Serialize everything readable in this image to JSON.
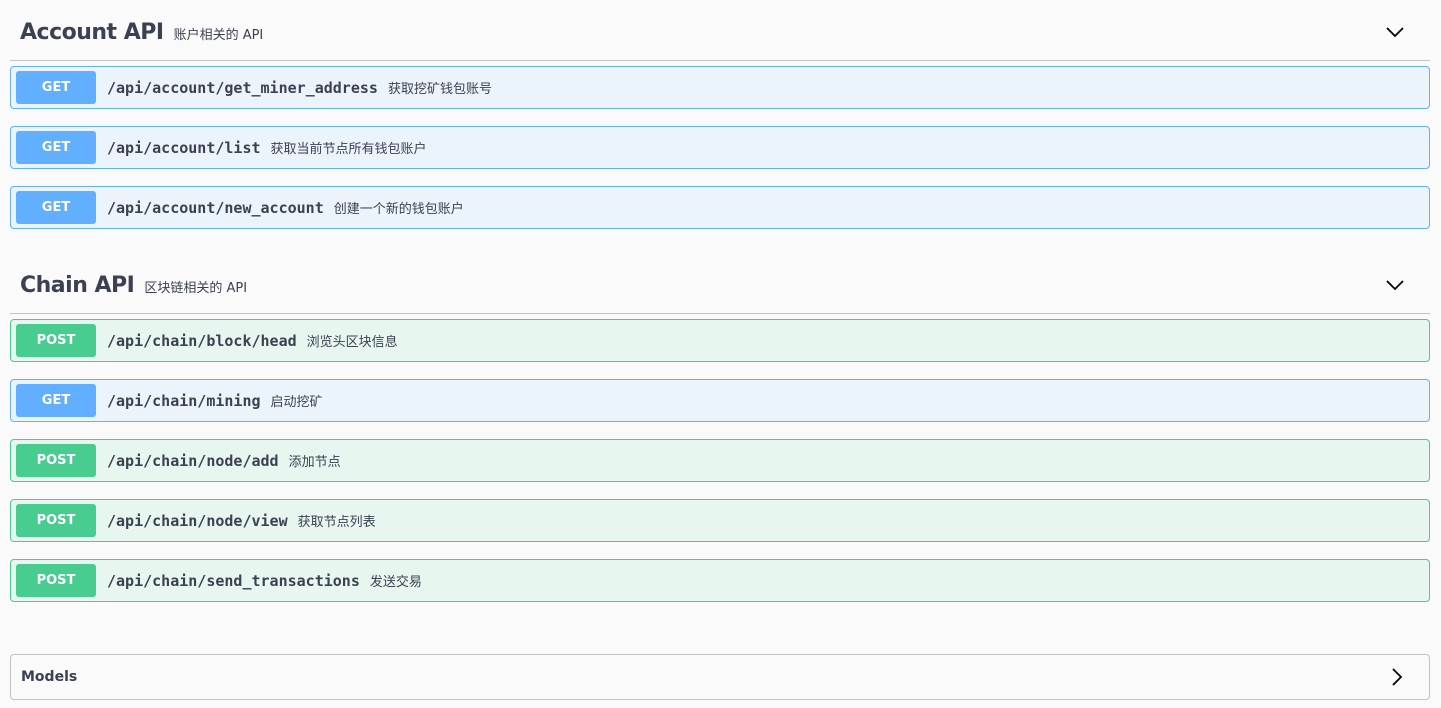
{
  "sections": [
    {
      "title": "Account API",
      "description": "账户相关的 API",
      "operations": [
        {
          "method": "GET",
          "path": "/api/account/get_miner_address",
          "summary": "获取挖矿钱包账号"
        },
        {
          "method": "GET",
          "path": "/api/account/list",
          "summary": "获取当前节点所有钱包账户"
        },
        {
          "method": "GET",
          "path": "/api/account/new_account",
          "summary": "创建一个新的钱包账户"
        }
      ]
    },
    {
      "title": "Chain API",
      "description": "区块链相关的 API",
      "operations": [
        {
          "method": "POST",
          "path": "/api/chain/block/head",
          "summary": "浏览头区块信息"
        },
        {
          "method": "GET",
          "path": "/api/chain/mining",
          "summary": "启动挖矿"
        },
        {
          "method": "POST",
          "path": "/api/chain/node/add",
          "summary": "添加节点"
        },
        {
          "method": "POST",
          "path": "/api/chain/node/view",
          "summary": "获取节点列表"
        },
        {
          "method": "POST",
          "path": "/api/chain/send_transactions",
          "summary": "发送交易"
        }
      ]
    }
  ],
  "models": {
    "title": "Models"
  },
  "icons": {
    "section_toggle": "chevron-down-icon",
    "models_toggle": "chevron-right-icon"
  },
  "colors": {
    "get": "#61affe",
    "post": "#49cc90",
    "get_bg": "#ebf3fb",
    "post_bg": "#e8f6f0",
    "text": "#3b4151"
  }
}
